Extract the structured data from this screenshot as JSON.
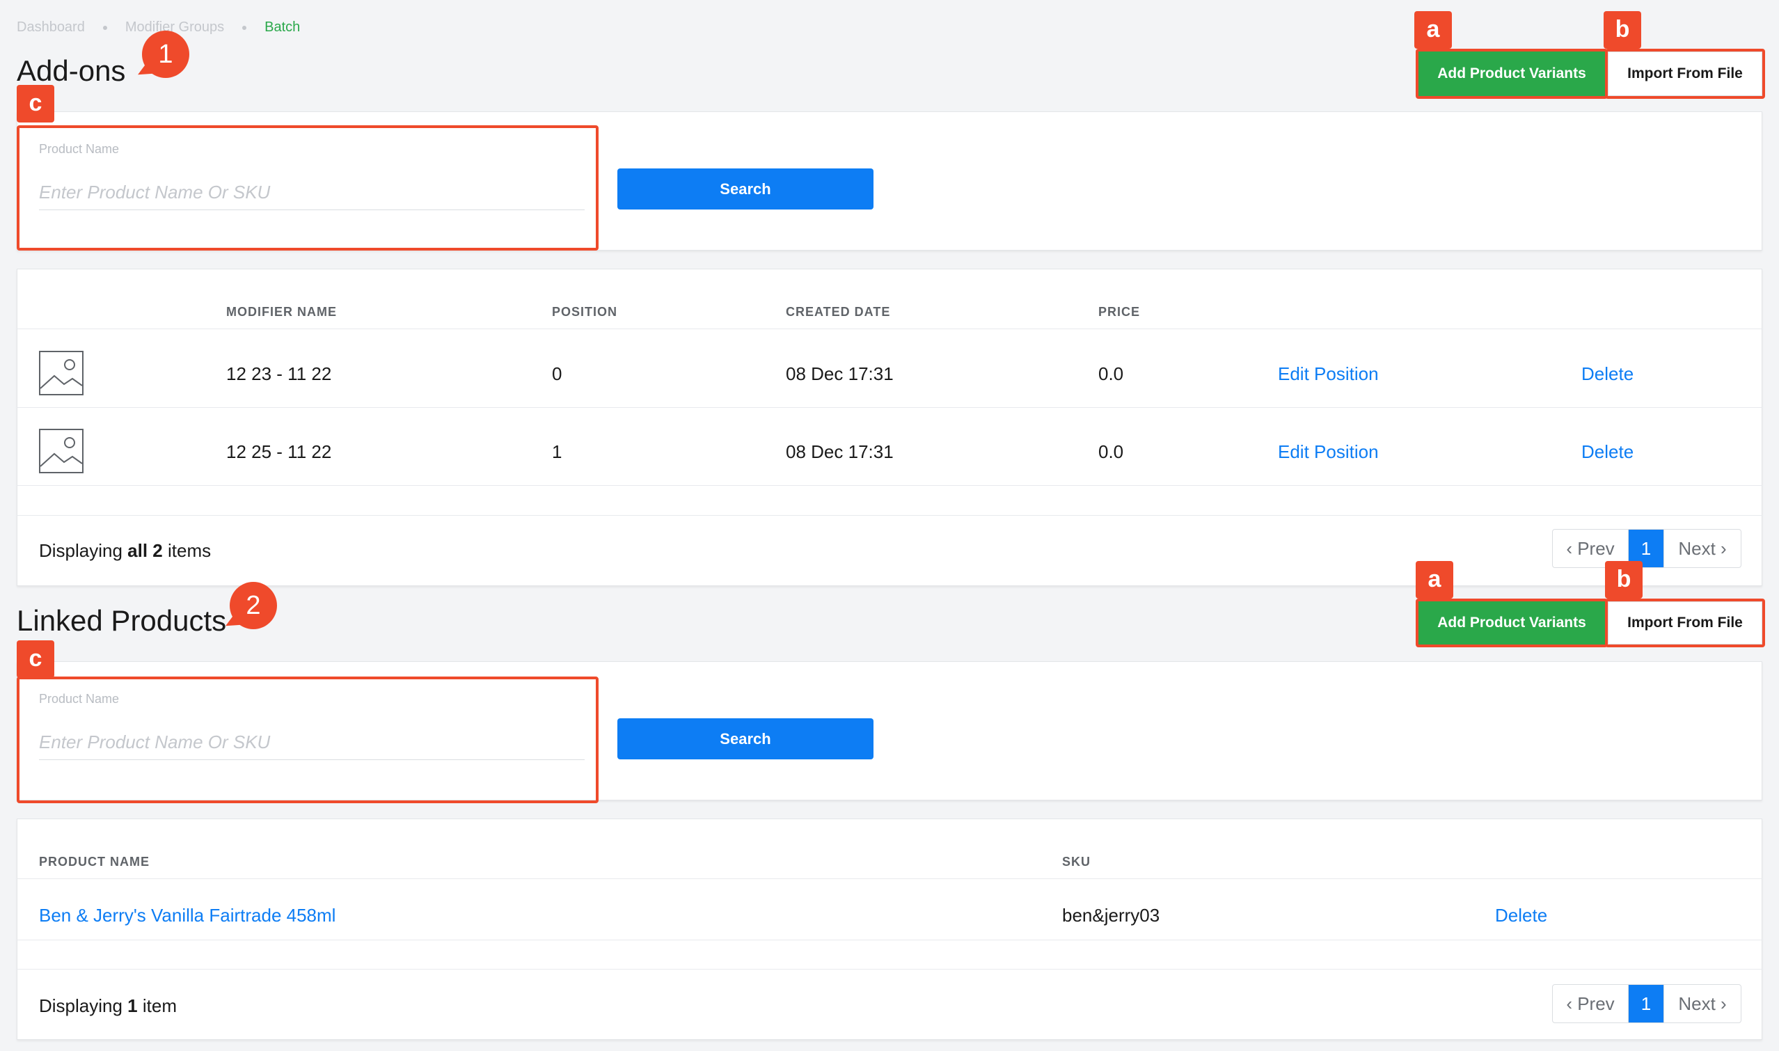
{
  "breadcrumb": [
    "Dashboard",
    "Modifier Groups",
    "Batch"
  ],
  "addons": {
    "title": "Add-ons",
    "bubble": "1",
    "marker_a": "a",
    "marker_b": "b",
    "marker_c": "c",
    "add_label": "Add Product Variants",
    "import_label": "Import From File",
    "search": {
      "label": "Product Name",
      "placeholder": "Enter Product Name Or SKU",
      "button": "Search"
    },
    "table": {
      "headers": [
        "MODIFIER NAME",
        "POSITION",
        "CREATED DATE",
        "PRICE"
      ],
      "rows": [
        {
          "name": "12 23 - 11 22",
          "position": "0",
          "created": "08 Dec 17:31",
          "price": "0.0",
          "edit": "Edit Position",
          "delete": "Delete"
        },
        {
          "name": "12 25 - 11 22",
          "position": "1",
          "created": "08 Dec 17:31",
          "price": "0.0",
          "edit": "Edit Position",
          "delete": "Delete"
        }
      ]
    },
    "footer": {
      "prefix": "Displaying ",
      "strong": "all 2",
      "suffix": " items"
    },
    "pager": {
      "prev": "‹ Prev",
      "current": "1",
      "next": "Next ›"
    }
  },
  "linked": {
    "title": "Linked Products",
    "bubble": "2",
    "marker_a": "a",
    "marker_b": "b",
    "marker_c": "c",
    "add_label": "Add Product Variants",
    "import_label": "Import From File",
    "search": {
      "label": "Product Name",
      "placeholder": "Enter Product Name Or SKU",
      "button": "Search"
    },
    "table": {
      "headers": [
        "PRODUCT NAME",
        "SKU"
      ],
      "rows": [
        {
          "name": "Ben & Jerry's Vanilla Fairtrade 458ml",
          "sku": "ben&jerry03",
          "delete": "Delete"
        }
      ]
    },
    "footer": {
      "prefix": "Displaying ",
      "strong": "1",
      "suffix": " item"
    },
    "pager": {
      "prev": "‹ Prev",
      "current": "1",
      "next": "Next ›"
    }
  },
  "colors": {
    "accent_blue": "#0d7df4",
    "green": "#2aa84a",
    "annotation_red": "#ef4a2b"
  }
}
